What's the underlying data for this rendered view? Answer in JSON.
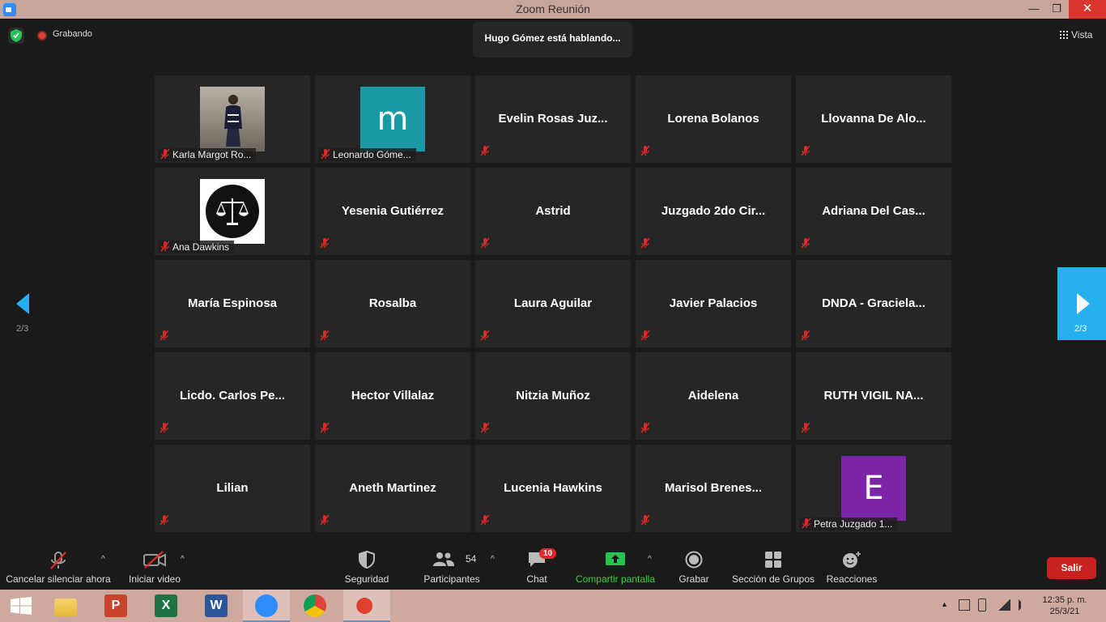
{
  "window": {
    "title": "Zoom Reunión",
    "minimize": "—",
    "restore": "❐",
    "close": "✕"
  },
  "topbar": {
    "recording": "Grabando",
    "speaking": "Hugo Gómez está hablando...",
    "view": "Vista"
  },
  "pagination": {
    "left": "2/3",
    "right": "2/3"
  },
  "tiles": [
    {
      "name": "Karla Margot Ro...",
      "type": "photo"
    },
    {
      "name": "Leonardo Góme...",
      "type": "avatar",
      "letter": "m",
      "color": "#1a9aa6"
    },
    {
      "name": "Evelin  Rosas  Juz...",
      "type": "text"
    },
    {
      "name": "Lorena Bolanos",
      "type": "text"
    },
    {
      "name": "Llovanna  De  Alo...",
      "type": "text"
    },
    {
      "name": "Ana Dawkins",
      "type": "justice"
    },
    {
      "name": "Yesenia Gutiérrez",
      "type": "text"
    },
    {
      "name": "Astrid",
      "type": "text"
    },
    {
      "name": "Juzgado  2do  Cir...",
      "type": "text"
    },
    {
      "name": "Adriana  Del  Cas...",
      "type": "text"
    },
    {
      "name": "María Espinosa",
      "type": "text"
    },
    {
      "name": "Rosalba",
      "type": "text"
    },
    {
      "name": "Laura Aguilar",
      "type": "text"
    },
    {
      "name": "Javier Palacios",
      "type": "text"
    },
    {
      "name": "DNDA  -  Graciela...",
      "type": "text"
    },
    {
      "name": "Licdo.  Carlos  Pe...",
      "type": "text"
    },
    {
      "name": "Hector Villalaz",
      "type": "text"
    },
    {
      "name": "Nitzia Muñoz",
      "type": "text"
    },
    {
      "name": "Aidelena",
      "type": "text"
    },
    {
      "name": "RUTH VIGIL NA...",
      "type": "text"
    },
    {
      "name": "Lilian",
      "type": "text"
    },
    {
      "name": "Aneth Martinez",
      "type": "text"
    },
    {
      "name": "Lucenia Hawkins",
      "type": "text"
    },
    {
      "name": "Marisol  Brenes...",
      "type": "text"
    },
    {
      "name": "Petra Juzgado 1...",
      "type": "avatar",
      "letter": "E",
      "color": "#7b24a6"
    }
  ],
  "toolbar": {
    "mute": "Cancelar silenciar ahora",
    "video": "Iniciar video",
    "security": "Seguridad",
    "participants": "Participantes",
    "participants_count": "54",
    "chat": "Chat",
    "chat_badge": "10",
    "share": "Compartir pantalla",
    "record": "Grabar",
    "breakout": "Sección de Grupos",
    "reactions": "Reacciones",
    "leave": "Salir"
  },
  "taskbar": {
    "time": "12:35 p. m.",
    "date": "25/3/21",
    "apps": [
      "windows-start",
      "file-explorer",
      "powerpoint",
      "excel",
      "word",
      "zoom",
      "chrome",
      "ccleaner"
    ]
  },
  "colors": {
    "accent_blue": "#25b0ef",
    "leave_red": "#c9211e",
    "share_green": "#38d338",
    "tile_bg": "#262626"
  }
}
